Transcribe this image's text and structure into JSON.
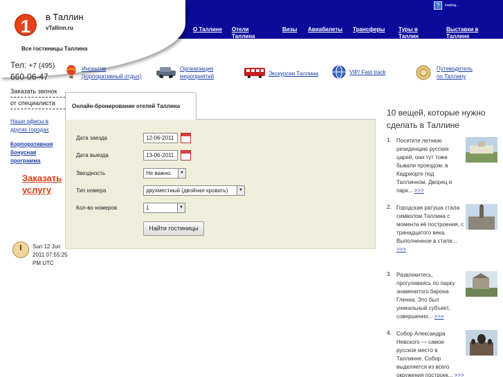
{
  "header": {
    "logo_digit": "1",
    "title": "в Таллин",
    "domain": "vTallinn.ru",
    "subtitle": "Все гостиницы Таллина",
    "loading_text": "loading..."
  },
  "nav": [
    "О Таллине",
    "Отели Таллина",
    "Визы",
    "Авиабилеты",
    "Трансферы",
    "Туры в Таллин",
    "Выставки в Таллине"
  ],
  "left": {
    "phone_label": "Тел:",
    "phone_code": "+7 (495)",
    "phone_number": "660-06-47",
    "callback_line1": "Заказать звонок",
    "callback_line2": "от специалиста",
    "offices": "Наши офисы в других городах",
    "bonus": "Корпоративная бонусная программа",
    "order_service": "Заказать услугу",
    "clock": "Sun 12 Jun 2011 07:55:25 PM UTC"
  },
  "services": [
    {
      "icon": "balloon-icon",
      "label_line1": "Инсентив",
      "label_line2": "(корпоративный отдых)"
    },
    {
      "icon": "car-icon",
      "label_line1": "Организация",
      "label_line2": "мероприятий"
    },
    {
      "icon": "bus-icon",
      "label_line1": "Экскурсии Таллина",
      "label_line2": ""
    },
    {
      "icon": "globe-icon",
      "label_line1": "VIP/ Fast track",
      "label_line2": ""
    },
    {
      "icon": "map-icon",
      "label_line1": "Путеводитель",
      "label_line2": "по Таллину"
    }
  ],
  "booking": {
    "tab_label": "Онлайн-бронирование отелей Таллина",
    "checkin_label": "Дата заезда",
    "checkin_value": "12-06-2011",
    "checkout_label": "Дата выезда",
    "checkout_value": "13-06-2011",
    "stars_label": "Звездность",
    "stars_value": "Не важно",
    "room_type_label": "Тип номера",
    "room_type_value": "двухместный (двойная кровать)",
    "rooms_label": "Кол-во номеров",
    "rooms_value": "1",
    "submit_label": "Найти гостиницы"
  },
  "things": {
    "title": "10 вещей, которые нужно сделать в Таллине",
    "items": [
      {
        "num": "1.",
        "text": "Посетите летнюю резиденцию русских царей, они тут тоже бывали проездом, в Кадриорге под Таллинном. Дворец и парк...",
        "more": ">>>"
      },
      {
        "num": "2.",
        "text": "Городская ратуша стала символом Таллина с момента её построения, с тринадцатого века. Выполненное в стиле...",
        "more": ">>>"
      },
      {
        "num": "3.",
        "text": "Развлекитесь, прогуливаясь по парку знаменитого барона Гленна. Это был уникальный субъект, совершенно...",
        "more": ">>>"
      },
      {
        "num": "4.",
        "text": "Собор Александра Невского — самое русское место в Таллинне. Собор выделяется из всего окружения построек...",
        "more": ">>>"
      }
    ]
  }
}
